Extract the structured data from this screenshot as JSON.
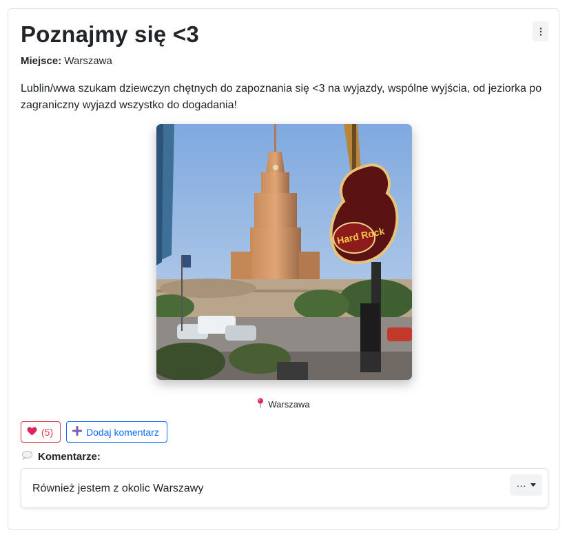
{
  "post": {
    "title": "Poznajmy się <3",
    "place_label": "Miejsce:",
    "place_value": "Warszawa",
    "description": "Lublin/wwa szukam dziewczyn chętnych do zapoznania się <3 na wyjazdy, wspólne wyjścia, od jeziorka po zagraniczny wyjazd wszystko do dogadania!",
    "photo_location": "Warszawa"
  },
  "actions": {
    "like_count": "(5)",
    "add_comment_label": "Dodaj komentarz"
  },
  "comments": {
    "heading": "Komentarze:",
    "items": [
      {
        "text": "Również jestem z okolic Warszawy",
        "menu_label": "···"
      }
    ]
  },
  "icons": {
    "options": "vertical-dots-icon",
    "location": "pin-icon",
    "like": "heart-icon",
    "add": "plus-icon",
    "comments": "speech-bubble-icon"
  },
  "colors": {
    "like": "#dc3545",
    "primary": "#0d6efd",
    "plus": "#7b5ea7"
  }
}
